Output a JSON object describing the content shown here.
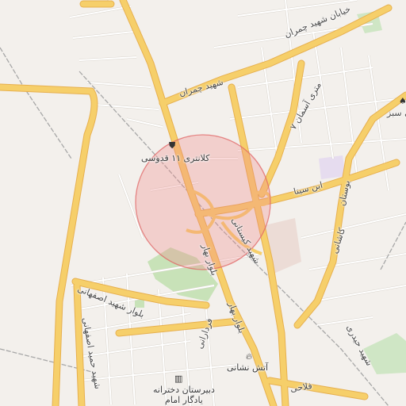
{
  "map": {
    "colors": {
      "background": "#f3f0ec",
      "major_road": "#f6cf6a",
      "major_road_casing": "#e7b04f",
      "minor_road": "#ffffff",
      "minor_road_casing": "#d9d4cc",
      "railway": "#a7a7a7",
      "park": "#c8e2b8",
      "selection_fill": "#f08a8a",
      "selection_stroke": "#e06565"
    },
    "selection_circle": {
      "visible": true
    },
    "street_labels": [
      {
        "text": "خیابان شهید چمران"
      },
      {
        "text": "شهید چمران"
      },
      {
        "text": "۷ متری آسمان"
      },
      {
        "text": "ابن سینا"
      },
      {
        "text": "بوستان"
      },
      {
        "text": "شهید کیستانی"
      },
      {
        "text": "بلوار بهار"
      },
      {
        "text": "بلوار بهار"
      },
      {
        "text": "کاشانی"
      },
      {
        "text": "شهید حیدری"
      },
      {
        "text": "بلوار شهید اصفهانی"
      },
      {
        "text": "شهید حمید اصفهانی"
      },
      {
        "text": "فردارانی"
      },
      {
        "text": "فلاحی"
      },
      {
        "text": "پی سبز"
      }
    ],
    "pois": [
      {
        "name": "کلانتری ۱۱ قدوسی",
        "icon": "police-icon"
      },
      {
        "name": "آتش نشانی",
        "icon": "fire-station-icon"
      },
      {
        "name": "دبیرستان دخترانه\nیادگار امام",
        "icon": "school-icon"
      },
      {
        "name": "",
        "icon": "map-pin-icon"
      }
    ]
  }
}
